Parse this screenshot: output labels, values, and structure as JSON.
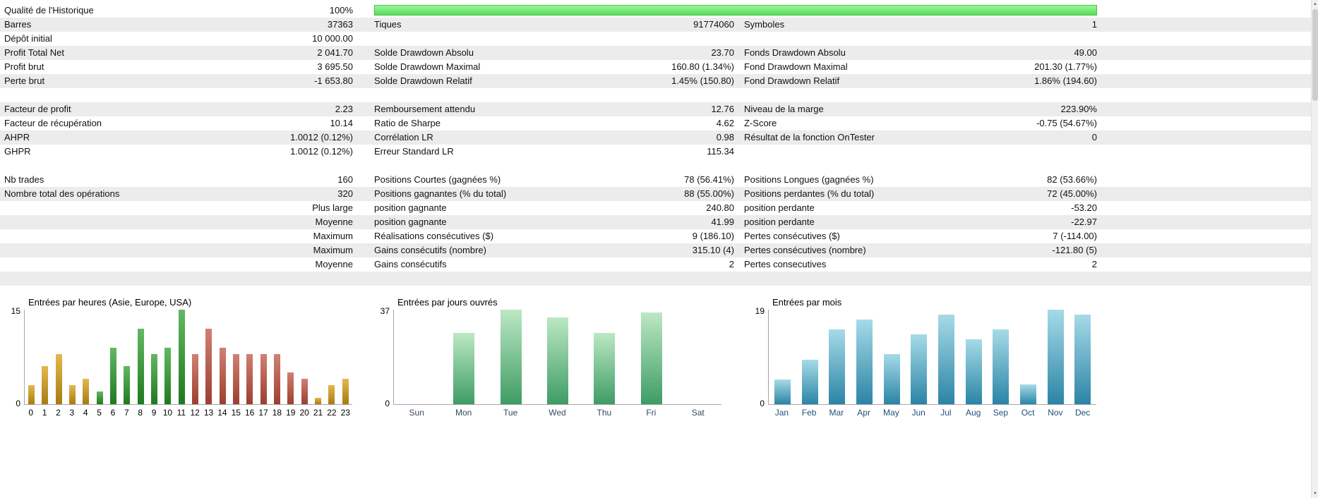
{
  "report": {
    "rows": [
      {
        "bg": "white",
        "type": "quality",
        "cells": [
          {
            "l": "Qualité de l'Historique",
            "v": "100%"
          }
        ],
        "bar": {
          "percent": 100,
          "color_top": "#98f798",
          "color_bottom": "#5adc5a",
          "border": "#46c246"
        }
      },
      {
        "bg": "gray",
        "cells": [
          {
            "l": "Barres",
            "v": "37363"
          },
          {
            "l": "Tiques",
            "v": "91774060"
          },
          {
            "l": "Symboles",
            "v": "1"
          }
        ]
      },
      {
        "bg": "white",
        "cells": [
          {
            "l": "Dépôt initial",
            "v": "10 000.00"
          },
          {
            "l": "",
            "v": ""
          },
          {
            "l": "",
            "v": ""
          }
        ]
      },
      {
        "bg": "gray",
        "cells": [
          {
            "l": "Profit Total Net",
            "v": "2 041.70"
          },
          {
            "l": "Solde Drawdown Absolu",
            "v": "23.70"
          },
          {
            "l": "Fonds Drawdown Absolu",
            "v": "49.00"
          }
        ]
      },
      {
        "bg": "white",
        "cells": [
          {
            "l": "Profit brut",
            "v": "3 695.50"
          },
          {
            "l": "Solde Drawdown Maximal",
            "v": "160.80 (1.34%)"
          },
          {
            "l": "Fond Drawdown Maximal",
            "v": "201.30 (1.77%)"
          }
        ]
      },
      {
        "bg": "gray",
        "cells": [
          {
            "l": "Perte brut",
            "v": "-1 653.80"
          },
          {
            "l": "Solde Drawdown Relatif",
            "v": "1.45% (150.80)"
          },
          {
            "l": "Fond Drawdown Relatif",
            "v": "1.86% (194.60)"
          }
        ]
      },
      {
        "bg": "white",
        "cells": []
      },
      {
        "bg": "gray",
        "cells": [
          {
            "l": "Facteur de profit",
            "v": "2.23"
          },
          {
            "l": "Remboursement attendu",
            "v": "12.76"
          },
          {
            "l": "Niveau de la marge",
            "v": "223.90%"
          }
        ]
      },
      {
        "bg": "white",
        "cells": [
          {
            "l": "Facteur de récupération",
            "v": "10.14"
          },
          {
            "l": "Ratio de Sharpe",
            "v": "4.62"
          },
          {
            "l": "Z-Score",
            "v": "-0.75 (54.67%)"
          }
        ]
      },
      {
        "bg": "gray",
        "cells": [
          {
            "l": "AHPR",
            "v": "1.0012 (0.12%)"
          },
          {
            "l": "Corrélation LR",
            "v": "0.98"
          },
          {
            "l": "Résultat de la fonction OnTester",
            "v": "0"
          }
        ]
      },
      {
        "bg": "white",
        "cells": [
          {
            "l": "GHPR",
            "v": "1.0012 (0.12%)"
          },
          {
            "l": "Erreur Standard LR",
            "v": "115.34"
          },
          {
            "l": "",
            "v": ""
          }
        ]
      },
      {
        "bg": "white",
        "cells": []
      },
      {
        "bg": "white",
        "cells": [
          {
            "l": "Nb trades",
            "v": "160"
          },
          {
            "l": "Positions Courtes (gagnées %)",
            "v": "78 (56.41%)"
          },
          {
            "l": "Positions Longues (gagnées %)",
            "v": "82 (53.66%)"
          }
        ]
      },
      {
        "bg": "gray",
        "cells": [
          {
            "l": "Nombre total des opérations",
            "v": "320"
          },
          {
            "l": "Positions gagnantes (% du total)",
            "v": "88 (55.00%)"
          },
          {
            "l": "Positions perdantes (% du total)",
            "v": "72 (45.00%)"
          }
        ]
      },
      {
        "bg": "white",
        "cells": [
          {
            "l": "",
            "v": "Plus large"
          },
          {
            "l": "position gagnante",
            "v": "240.80"
          },
          {
            "l": "position perdante",
            "v": "-53.20"
          }
        ]
      },
      {
        "bg": "gray",
        "cells": [
          {
            "l": "",
            "v": "Moyenne"
          },
          {
            "l": "position gagnante",
            "v": "41.99"
          },
          {
            "l": "position perdante",
            "v": "-22.97"
          }
        ]
      },
      {
        "bg": "white",
        "cells": [
          {
            "l": "",
            "v": "Maximum"
          },
          {
            "l": "Réalisations consécutives ($)",
            "v": "9 (186.10)"
          },
          {
            "l": "Pertes consécutives ($)",
            "v": "7 (-114.00)"
          }
        ]
      },
      {
        "bg": "gray",
        "cells": [
          {
            "l": "",
            "v": "Maximum"
          },
          {
            "l": "Gains consécutifs (nombre)",
            "v": "315.10 (4)"
          },
          {
            "l": "Pertes consécutives (nombre)",
            "v": "-121.80 (5)"
          }
        ]
      },
      {
        "bg": "white",
        "cells": [
          {
            "l": "",
            "v": "Moyenne"
          },
          {
            "l": "Gains consécutifs",
            "v": "2"
          },
          {
            "l": "Pertes consecutives",
            "v": "2"
          }
        ]
      },
      {
        "bg": "gray",
        "cells": []
      }
    ]
  },
  "chart_data": [
    {
      "type": "bar",
      "title": "Entrées par heures (Asie, Europe, USA)",
      "categories": [
        "0",
        "1",
        "2",
        "3",
        "4",
        "5",
        "6",
        "7",
        "8",
        "9",
        "10",
        "11",
        "12",
        "13",
        "14",
        "15",
        "16",
        "17",
        "18",
        "19",
        "20",
        "21",
        "22",
        "23"
      ],
      "values": [
        3,
        6,
        8,
        3,
        4,
        2,
        9,
        6,
        12,
        8,
        9,
        15,
        8,
        12,
        9,
        8,
        8,
        8,
        8,
        5,
        4,
        1,
        3,
        4
      ],
      "ylim": [
        0,
        15
      ],
      "ymax_label": "15",
      "ymin_label": "0",
      "bar_colors": [
        "asia",
        "asia",
        "asia",
        "asia",
        "asia",
        "europe",
        "europe",
        "europe",
        "europe",
        "europe",
        "europe",
        "europe",
        "usa",
        "usa",
        "usa",
        "usa",
        "usa",
        "usa",
        "usa",
        "usa",
        "usa",
        "asia",
        "asia",
        "asia"
      ],
      "palette": {
        "asia": [
          "#e2b94f",
          "#a97b10"
        ],
        "europe": [
          "#63b863",
          "#1e7a1e"
        ],
        "usa": [
          "#d08073",
          "#9c3f30"
        ]
      },
      "legend_position": "none",
      "grid": false
    },
    {
      "type": "bar",
      "title": "Entrées par jours ouvrés",
      "categories": [
        "Sun",
        "Mon",
        "Tue",
        "Wed",
        "Thu",
        "Fri",
        "Sat"
      ],
      "values": [
        0,
        28,
        37,
        34,
        28,
        36,
        0
      ],
      "ylim": [
        0,
        37
      ],
      "ymax_label": "37",
      "ymin_label": "0",
      "palette": {
        "default": [
          "#bce8c4",
          "#3e9c64"
        ]
      },
      "legend_position": "none",
      "grid": false
    },
    {
      "type": "bar",
      "title": "Entrées par mois",
      "categories": [
        "Jan",
        "Feb",
        "Mar",
        "Apr",
        "May",
        "Jun",
        "Jul",
        "Aug",
        "Sep",
        "Oct",
        "Nov",
        "Dec"
      ],
      "values": [
        5,
        9,
        15,
        17,
        10,
        14,
        18,
        13,
        15,
        4,
        19,
        18
      ],
      "ylim": [
        0,
        19
      ],
      "ymax_label": "19",
      "ymin_label": "0",
      "palette": {
        "default": [
          "#a6dbe8",
          "#2b84a6"
        ]
      },
      "legend_position": "none",
      "grid": false
    }
  ]
}
